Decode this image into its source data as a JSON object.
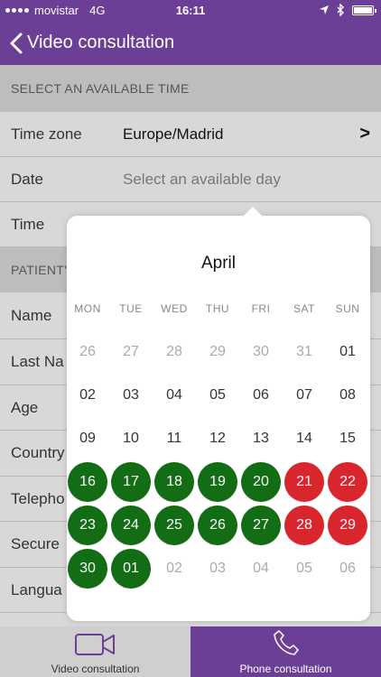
{
  "status_bar": {
    "carrier": "movistar",
    "network": "4G",
    "time": "16:11"
  },
  "nav": {
    "title": "Video consultation"
  },
  "section_time": "SELECT AN AVAILABLE TIME",
  "time_zone": {
    "label": "Time zone",
    "value": "Europe/Madrid",
    "chevron": ">"
  },
  "date": {
    "label": "Date",
    "placeholder": "Select an available day"
  },
  "time_row": {
    "label": "Time"
  },
  "section_patient": "PATIENT'",
  "patient_fields": [
    "Name",
    "Last Na",
    "Age",
    "Country",
    "Telepho",
    "Secure",
    "Langua"
  ],
  "calendar": {
    "month": "April",
    "weekdays": [
      "MON",
      "TUE",
      "WED",
      "THU",
      "FRI",
      "SAT",
      "SUN"
    ],
    "weeks": [
      [
        {
          "d": "26",
          "s": "muted"
        },
        {
          "d": "27",
          "s": "muted"
        },
        {
          "d": "28",
          "s": "muted"
        },
        {
          "d": "29",
          "s": "muted"
        },
        {
          "d": "30",
          "s": "muted"
        },
        {
          "d": "31",
          "s": "muted"
        },
        {
          "d": "01",
          "s": "normal"
        }
      ],
      [
        {
          "d": "02",
          "s": "normal"
        },
        {
          "d": "03",
          "s": "normal"
        },
        {
          "d": "04",
          "s": "normal"
        },
        {
          "d": "05",
          "s": "normal"
        },
        {
          "d": "06",
          "s": "normal"
        },
        {
          "d": "07",
          "s": "normal"
        },
        {
          "d": "08",
          "s": "normal"
        }
      ],
      [
        {
          "d": "09",
          "s": "normal"
        },
        {
          "d": "10",
          "s": "normal"
        },
        {
          "d": "11",
          "s": "normal"
        },
        {
          "d": "12",
          "s": "normal"
        },
        {
          "d": "13",
          "s": "normal"
        },
        {
          "d": "14",
          "s": "normal"
        },
        {
          "d": "15",
          "s": "normal"
        }
      ],
      [
        {
          "d": "16",
          "s": "available"
        },
        {
          "d": "17",
          "s": "available"
        },
        {
          "d": "18",
          "s": "available"
        },
        {
          "d": "19",
          "s": "available"
        },
        {
          "d": "20",
          "s": "available"
        },
        {
          "d": "21",
          "s": "full"
        },
        {
          "d": "22",
          "s": "full"
        }
      ],
      [
        {
          "d": "23",
          "s": "available"
        },
        {
          "d": "24",
          "s": "available"
        },
        {
          "d": "25",
          "s": "available"
        },
        {
          "d": "26",
          "s": "available"
        },
        {
          "d": "27",
          "s": "available"
        },
        {
          "d": "28",
          "s": "full"
        },
        {
          "d": "29",
          "s": "full"
        }
      ],
      [
        {
          "d": "30",
          "s": "available"
        },
        {
          "d": "01",
          "s": "available"
        },
        {
          "d": "02",
          "s": "muted"
        },
        {
          "d": "03",
          "s": "muted"
        },
        {
          "d": "04",
          "s": "muted"
        },
        {
          "d": "05",
          "s": "muted"
        },
        {
          "d": "06",
          "s": "muted"
        }
      ]
    ]
  },
  "tabs": {
    "video": "Video consultation",
    "phone": "Phone consultation"
  },
  "colors": {
    "brand": "#6c3f96",
    "available": "#136d14",
    "full": "#d9262c"
  }
}
